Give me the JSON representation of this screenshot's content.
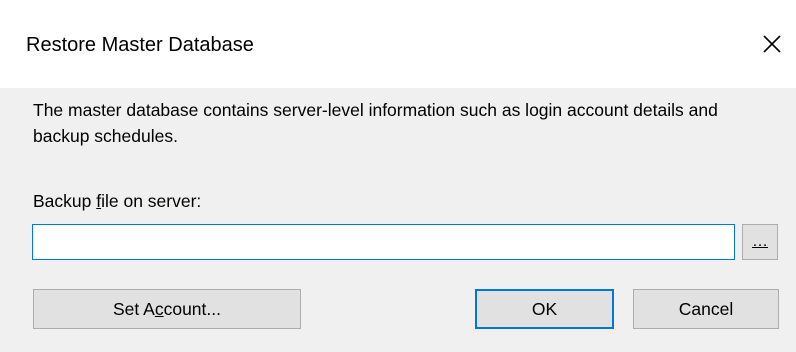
{
  "window": {
    "title": "Restore Master Database",
    "close_icon": "close-icon"
  },
  "description": "The master database contains server-level information such as login account details and backup schedules.",
  "backup_field": {
    "label_before": "Backup ",
    "label_underlined": "f",
    "label_after": "ile on server:",
    "value": "",
    "placeholder": ""
  },
  "browse_button": {
    "label_before": "",
    "label_underlined": "…",
    "label_after": ""
  },
  "buttons": {
    "set_account": {
      "label_before": "Set A",
      "label_underlined": "c",
      "label_after": "count..."
    },
    "ok": {
      "label": "OK"
    },
    "cancel": {
      "label": "Cancel"
    }
  },
  "colors": {
    "accent": "#0078d7",
    "dialog_bg": "#f0f0f0",
    "button_bg": "#e1e1e1",
    "button_border": "#adadad"
  }
}
